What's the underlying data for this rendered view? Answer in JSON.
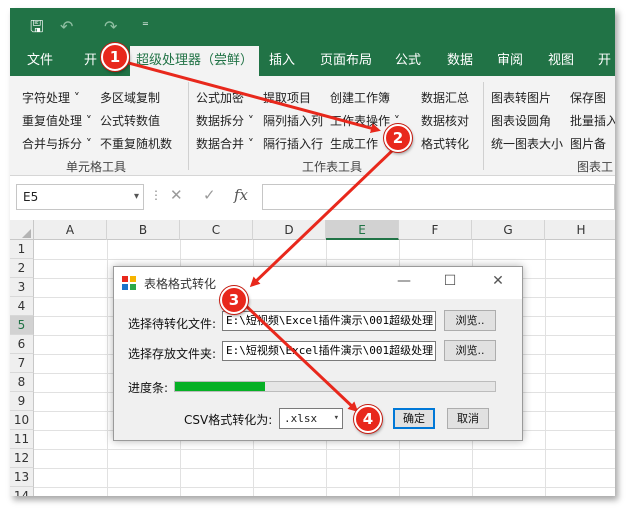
{
  "qat": {
    "save": "🖫",
    "undo": "↶",
    "redo": "↷",
    "customize": "⁼"
  },
  "tabs": [
    "文件",
    "开",
    "超级处理器（尝鲜）",
    "插入",
    "页面布局",
    "公式",
    "数据",
    "审阅",
    "视图",
    "开"
  ],
  "ribbon": {
    "cell_tools": {
      "items": [
        "字符处理 ˅",
        "多区域复制",
        "重复值处理 ˅",
        "公式转数值",
        "合并与拆分 ˅",
        "不重复随机数"
      ],
      "label": "单元格工具"
    },
    "sheet_tools": {
      "items": [
        "公式加密",
        "提取项目",
        "创建工作簿",
        "数据汇总",
        "数据拆分 ˅",
        "隔列插入列",
        "工作表操作 ˅",
        "数据核对",
        "数据合并 ˅",
        "隔行插入行",
        "生成工作",
        "格式转化"
      ],
      "label": "工作表工具"
    },
    "chart_tools": {
      "items": [
        "图表转图片",
        "保存图",
        "图表设圆角",
        "批量插入",
        "统一图表大小",
        "图片备"
      ],
      "label": "图表工"
    }
  },
  "formula_bar": {
    "name_box": "E5",
    "cancel": "✕",
    "confirm": "✓",
    "fx": "fx"
  },
  "grid": {
    "columns": [
      "A",
      "B",
      "C",
      "D",
      "E",
      "F",
      "G",
      "H"
    ],
    "rows": [
      "1",
      "2",
      "3",
      "4",
      "5",
      "6",
      "7",
      "8",
      "9",
      "10",
      "11",
      "12",
      "13",
      "14"
    ],
    "selected_cell": "E5"
  },
  "dialog": {
    "title": "表格格式转化",
    "minimize": "—",
    "maximize": "☐",
    "close": "✕",
    "source_label": "选择待转化文件:",
    "source_path": "E:\\短视频\\Excel插件演示\\001超级处理",
    "browse1": "浏览..",
    "dest_label": "选择存放文件夹:",
    "dest_path": "E:\\短视频\\Excel插件演示\\001超级处理",
    "browse2": "浏览..",
    "progress_label": "进度条:",
    "progress": 0.28,
    "csv_label": "CSV格式转化为:",
    "format_value": ".xlsx",
    "ok": "确定",
    "cancel": "取消"
  },
  "annotations": [
    "1",
    "2",
    "3",
    "4"
  ],
  "colors": {
    "excel_green": "#217346",
    "annotation_red": "#e8281c",
    "progress_green": "#06b025"
  }
}
